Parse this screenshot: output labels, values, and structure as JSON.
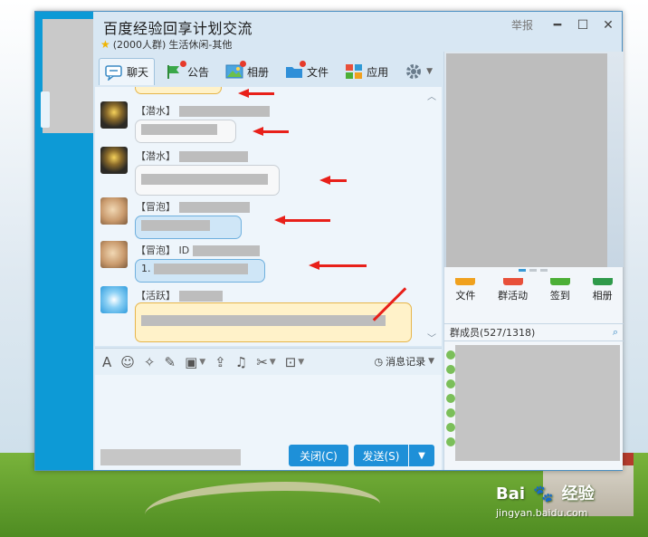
{
  "window": {
    "title": "百度经验回享计划交流",
    "group_size": "(2000人群)",
    "group_category": "生活休闲-其他",
    "report_label": "举报"
  },
  "tabs": [
    {
      "label": "聊天",
      "icon": "chat-bubble-icon"
    },
    {
      "label": "公告",
      "icon": "flag-icon"
    },
    {
      "label": "相册",
      "icon": "photo-album-icon"
    },
    {
      "label": "文件",
      "icon": "folder-icon"
    },
    {
      "label": "应用",
      "icon": "apps-grid-icon"
    }
  ],
  "messages": [
    {
      "tag": "【潜水】",
      "avatar": "penguin-avatar",
      "bubble": "gray"
    },
    {
      "tag": "【潜水】",
      "avatar": "penguin-avatar",
      "bubble": "gray"
    },
    {
      "tag": "【冒泡】",
      "avatar": "face-avatar",
      "bubble": "blue"
    },
    {
      "tag": "【冒泡】",
      "avatar": "face-avatar",
      "bubble": "blue",
      "id_prefix": "ID",
      "content_prefix": "1."
    },
    {
      "tag": "【活跃】",
      "avatar": "blue-avatar",
      "bubble": "yellow"
    }
  ],
  "toolbar": {
    "history_label": "消息记录"
  },
  "buttons": {
    "close_label": "关闭(C)",
    "send_label": "发送(S)"
  },
  "right_panel": {
    "apps": [
      {
        "label": "文件",
        "color": "#f0a11e"
      },
      {
        "label": "群活动",
        "color": "#e8503a"
      },
      {
        "label": "签到",
        "color": "#4caf36"
      },
      {
        "label": "相册",
        "color": "#2f9a4a"
      }
    ],
    "members_label": "群成员(527/1318)"
  },
  "watermark": {
    "brand": "Bai",
    "brand_tail": "经验",
    "url": "jingyan.baidu.com"
  },
  "colors": {
    "accent": "#1e90d8",
    "sidebar": "#0d9ad6",
    "arrow": "#e8201a"
  }
}
